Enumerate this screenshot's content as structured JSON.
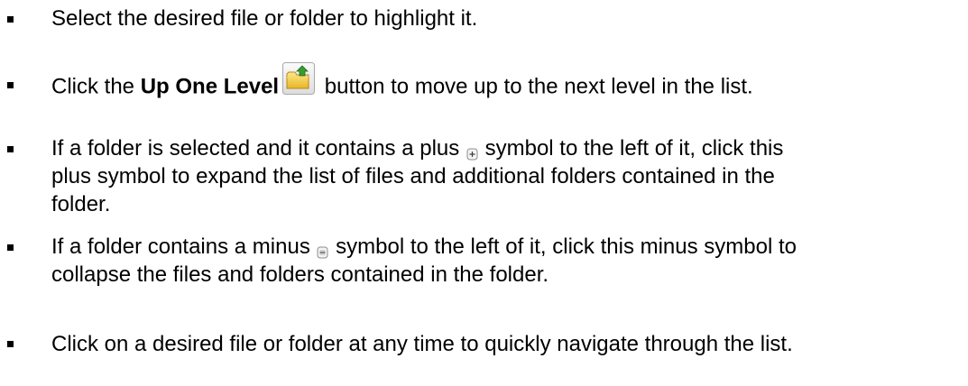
{
  "items": [
    {
      "text": "Select the desired file or folder to highlight it."
    },
    {
      "before": "Click the ",
      "bold": "Up One Level",
      "icon": "up-one-level-folder-icon",
      "after": " button to move up to the next level in the list."
    },
    {
      "before": "If a folder is selected and it contains a plus ",
      "icon": "plus-expand-icon",
      "line1_after": " symbol to the left of it, click this",
      "line2": "plus symbol to expand the list of files and additional folders contained in the",
      "line3": "folder."
    },
    {
      "before": "If a folder contains a minus ",
      "icon": "minus-collapse-icon",
      "line1_after": " symbol to the left of it, click this minus symbol to",
      "line2": "collapse the files and folders contained in the folder."
    },
    {
      "text": "Click on a desired file or folder at any time to quickly navigate through the list."
    }
  ],
  "colors": {
    "text": "#000000",
    "background": "#ffffff",
    "icon_folder": "#f0c330",
    "icon_arrow": "#3a9b2e"
  }
}
